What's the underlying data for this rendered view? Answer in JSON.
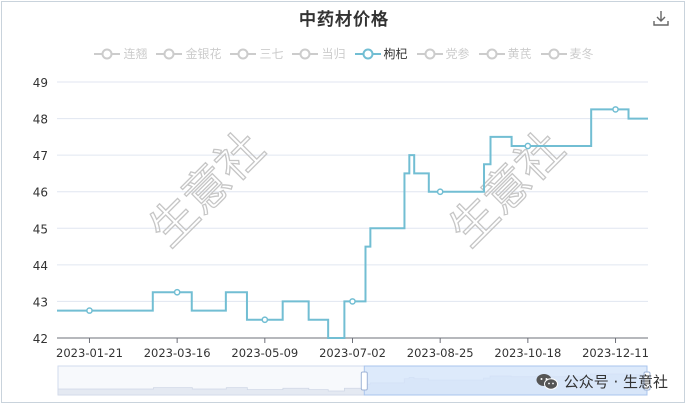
{
  "header": {
    "title": "中药材价格",
    "download_icon": "download-icon"
  },
  "legend": {
    "items": [
      {
        "label": "连翘",
        "active": false
      },
      {
        "label": "金银花",
        "active": false
      },
      {
        "label": "三七",
        "active": false
      },
      {
        "label": "当归",
        "active": false
      },
      {
        "label": "枸杞",
        "active": true
      },
      {
        "label": "党参",
        "active": false
      },
      {
        "label": "黄芪",
        "active": false
      },
      {
        "label": "麦冬",
        "active": false
      }
    ]
  },
  "watermarks": {
    "chart_text": "生意社",
    "social": "公众号 · 生意社",
    "social_icon": "wechat-icon"
  },
  "colors": {
    "series": "#72bed3",
    "inactive": "#cccccc",
    "slider_fill": "#d4e4fb",
    "slider_border": "#a9c4ed"
  },
  "chart_data": {
    "type": "line",
    "title": "中药材价格",
    "xlabel": "",
    "ylabel": "",
    "x_ticks": [
      "2023-01-21",
      "2023-03-16",
      "2023-05-09",
      "2023-07-02",
      "2023-08-25",
      "2023-10-18",
      "2023-12-11"
    ],
    "x_range": [
      "2023-01-01",
      "2023-12-31"
    ],
    "ylim": [
      42,
      49
    ],
    "y_ticks": [
      42,
      43,
      44,
      45,
      46,
      47,
      48,
      49
    ],
    "grid": true,
    "legend_position": "top",
    "series": [
      {
        "name": "枸杞",
        "step": true,
        "points": [
          [
            "2023-01-01",
            42.75
          ],
          [
            "2023-03-01",
            43.25
          ],
          [
            "2023-03-25",
            42.75
          ],
          [
            "2023-04-15",
            43.25
          ],
          [
            "2023-04-28",
            42.5
          ],
          [
            "2023-05-20",
            43
          ],
          [
            "2023-06-05",
            42.5
          ],
          [
            "2023-06-17",
            42
          ],
          [
            "2023-06-27",
            43
          ],
          [
            "2023-07-10",
            44.5
          ],
          [
            "2023-07-13",
            45
          ],
          [
            "2023-08-03",
            46.5
          ],
          [
            "2023-08-06",
            47
          ],
          [
            "2023-08-09",
            46.5
          ],
          [
            "2023-08-18",
            46
          ],
          [
            "2023-09-21",
            46.75
          ],
          [
            "2023-09-25",
            47.5
          ],
          [
            "2023-10-08",
            47.25
          ],
          [
            "2023-11-26",
            48.25
          ],
          [
            "2023-12-19",
            48
          ],
          [
            "2023-12-31",
            48
          ]
        ],
        "markers": [
          [
            "2023-01-21",
            42.75
          ],
          [
            "2023-03-16",
            43.25
          ],
          [
            "2023-05-09",
            42.5
          ],
          [
            "2023-07-02",
            43
          ],
          [
            "2023-08-25",
            46
          ],
          [
            "2023-10-18",
            47.25
          ],
          [
            "2023-12-11",
            48.25
          ]
        ]
      }
    ],
    "data_zoom": {
      "range_start": 0.52,
      "range_end": 1.0
    }
  }
}
